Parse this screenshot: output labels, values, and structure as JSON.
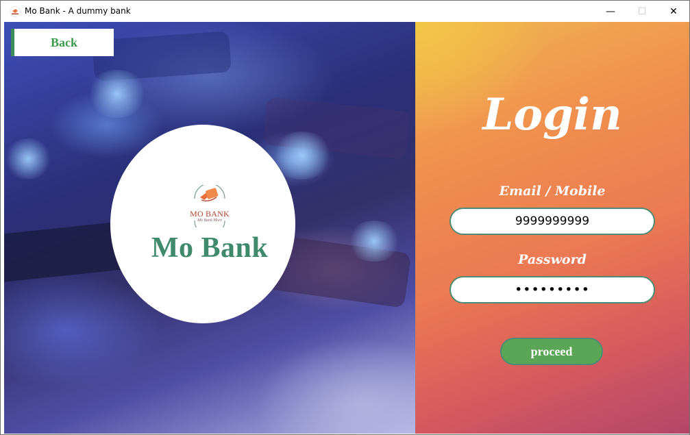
{
  "window": {
    "title": "Mo Bank - A dummy bank",
    "minimize_glyph": "—",
    "maximize_glyph": "☐",
    "close_glyph": "✕"
  },
  "left_panel": {
    "back_label": "Back",
    "logo": {
      "brand": "MO BANK",
      "tagline": "Mo Bank More",
      "icon": "wallet-card-icon"
    },
    "bank_name": "Mo Bank"
  },
  "login": {
    "title": "Login",
    "email_label": "Email / Mobile",
    "email_value": "9999999999",
    "password_label": "Password",
    "password_value": "*********",
    "proceed_label": "proceed"
  },
  "colors": {
    "accent_green": "#5aa656",
    "border_green": "#4e8b74",
    "bank_name_green": "#3f8a6a",
    "gradient_top": "#f1b650",
    "gradient_bottom": "#b4456a"
  }
}
